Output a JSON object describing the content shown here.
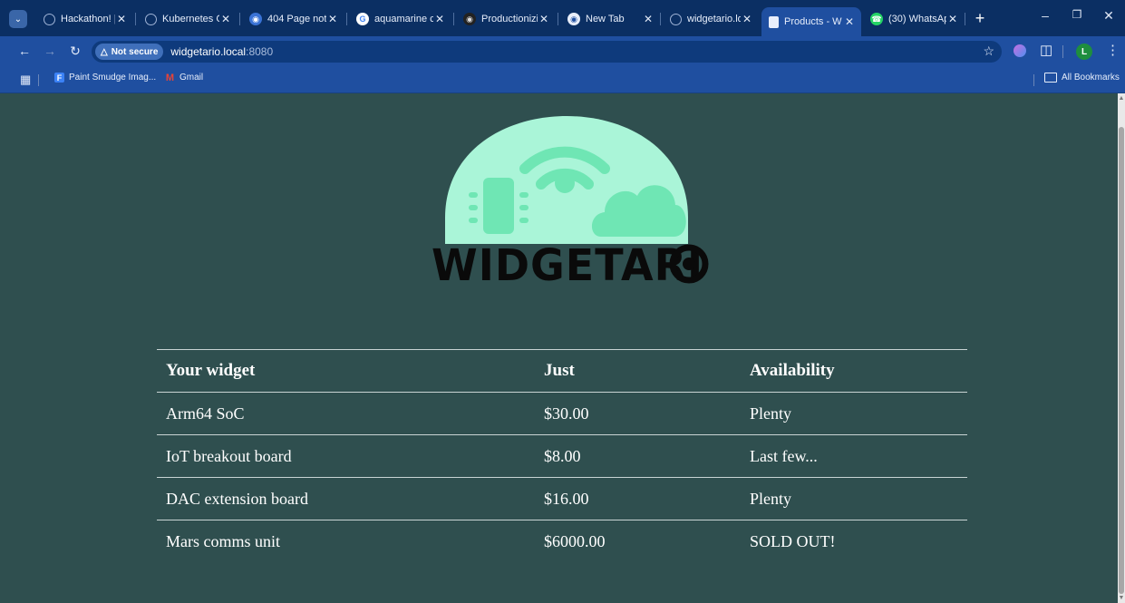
{
  "browser": {
    "tabs": [
      {
        "title": "Hackathon! |",
        "icon": "globe-icon",
        "active": false
      },
      {
        "title": "Kubernetes C",
        "icon": "globe-icon",
        "active": false
      },
      {
        "title": "404 Page not",
        "icon": "helm-icon",
        "active": false
      },
      {
        "title": "aquamarine c",
        "icon": "google-icon",
        "active": false
      },
      {
        "title": "Productionizi",
        "icon": "target-icon",
        "active": false
      },
      {
        "title": "New Tab",
        "icon": "chrome-icon",
        "active": false
      },
      {
        "title": "widgetario.lo",
        "icon": "globe-icon",
        "active": false
      },
      {
        "title": "Products - W",
        "icon": "document-icon",
        "active": true
      },
      {
        "title": "(30) WhatsAp",
        "icon": "whatsapp-icon",
        "active": false
      }
    ],
    "new_tab_label": "+",
    "address": {
      "security_label": "Not secure",
      "host": "widgetario.local",
      "port": ":8080"
    },
    "profile_initial": "L",
    "bookmarks": [
      {
        "label": "Paint Smudge Imag...",
        "icon": "bookmark-f-icon"
      },
      {
        "label": "Gmail",
        "icon": "gmail-icon"
      }
    ],
    "all_bookmarks_label": "All Bookmarks"
  },
  "page": {
    "logo_text": "WIDGETARI",
    "table": {
      "headers": [
        "Your widget",
        "Just",
        "Availability"
      ],
      "rows": [
        {
          "name": "Arm64 SoC",
          "price": "$30.00",
          "availability": "Plenty"
        },
        {
          "name": "IoT breakout board",
          "price": "$8.00",
          "availability": "Last few..."
        },
        {
          "name": "DAC extension board",
          "price": "$16.00",
          "availability": "Plenty"
        },
        {
          "name": "Mars comms unit",
          "price": "$6000.00",
          "availability": "SOLD OUT!"
        }
      ]
    }
  },
  "colors": {
    "page_background": "#2f4f4f",
    "logo_mint": "#aaf5d8",
    "logo_green": "#6fe6b4",
    "browser_frame": "#1f4fa0"
  }
}
